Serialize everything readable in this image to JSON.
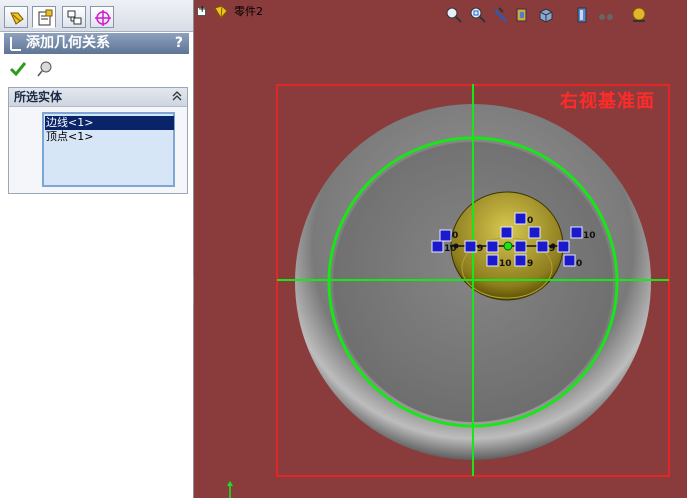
{
  "property_manager": {
    "tabs": [
      {
        "icon": "feature-manager-icon"
      },
      {
        "icon": "property-manager-icon"
      },
      {
        "icon": "configuration-manager-icon"
      },
      {
        "icon": "dimxpert-manager-icon"
      }
    ],
    "title": "添加几何关系",
    "help_label": "?",
    "ok_icon": "checkmark-icon",
    "pin_icon": "pushpin-icon",
    "selected_entities": {
      "title": "所选实体",
      "items": [
        {
          "label": "边线<1>",
          "selected": true
        },
        {
          "label": "顶点<1>",
          "selected": false
        }
      ]
    }
  },
  "graphics": {
    "part_name": "零件2",
    "plane_label": "右视基准面",
    "toolbar_icons": [
      "zoom-to-fit-icon",
      "zoom-area-icon",
      "previous-view-icon",
      "section-view-icon",
      "view-orientation-icon",
      "display-style-icon",
      "hide-show-items-icon",
      "edit-appearance-icon"
    ],
    "relation_labels": [
      "0",
      "10",
      "9",
      "10",
      "9",
      "9",
      "10",
      "0",
      "0",
      "10"
    ],
    "colors": {
      "background": "#8a3c3c",
      "sketch_green": "#19e619",
      "plane_border": "#ff1e1e",
      "relation_blue": "#1a1acc",
      "part_gray": "#7d7d7d",
      "highlight_yellow": "#b8a83a"
    }
  }
}
